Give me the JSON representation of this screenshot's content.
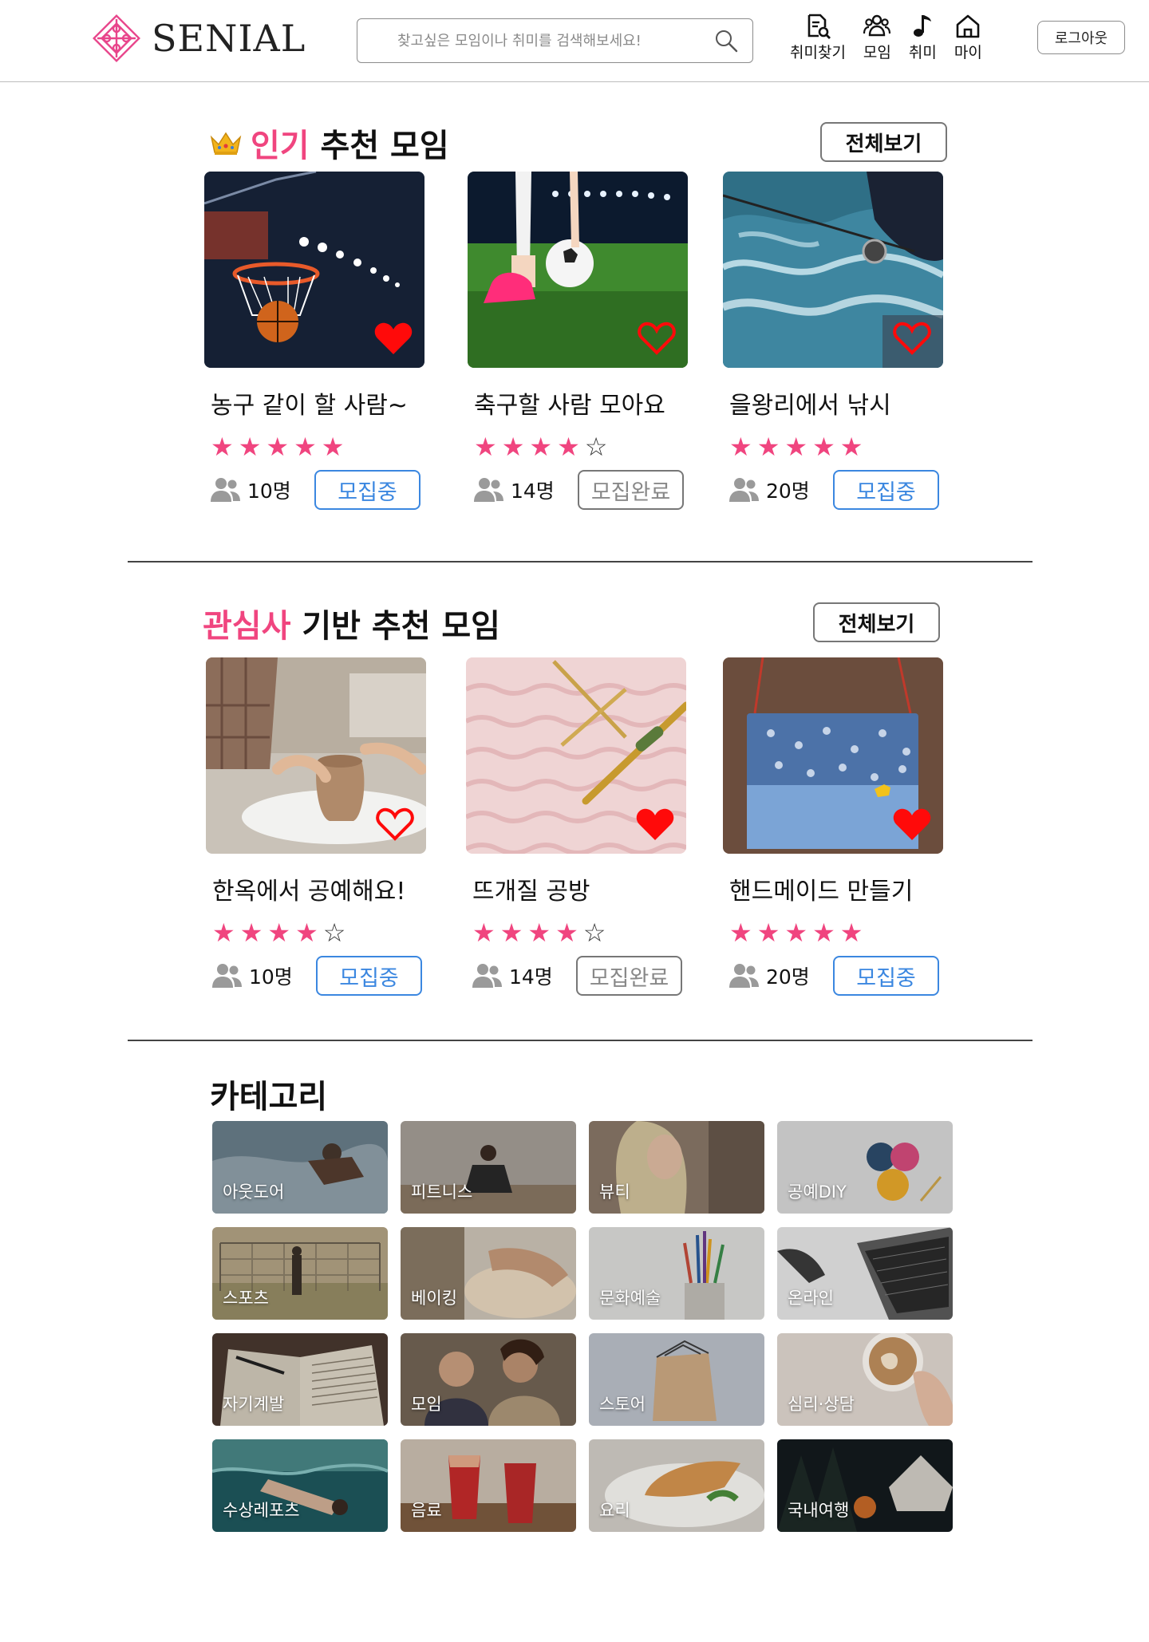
{
  "header": {
    "brand": "SENIAL",
    "search_placeholder": "찾고싶은 모임이나 취미를 검색해보세요!",
    "nav": [
      {
        "label": "취미찾기",
        "icon": "hobby-search-icon"
      },
      {
        "label": "모임",
        "icon": "group-icon"
      },
      {
        "label": "취미",
        "icon": "music-note-icon"
      },
      {
        "label": "마이",
        "icon": "home-icon"
      }
    ],
    "logout_label": "로그아웃"
  },
  "popular": {
    "title_highlight": "인기",
    "title_rest": " 추천 모임",
    "view_all": "전체보기",
    "cards": [
      {
        "title": "농구 같이 할 사람~",
        "rating": 5,
        "members": "10명",
        "status": "모집중",
        "status_type": "open",
        "liked": true
      },
      {
        "title": "축구할 사람 모아요",
        "rating": 4,
        "members": "14명",
        "status": "모집완료",
        "status_type": "closed",
        "liked": false
      },
      {
        "title": "을왕리에서 낚시",
        "rating": 5,
        "members": "20명",
        "status": "모집중",
        "status_type": "open",
        "liked": false
      }
    ]
  },
  "interest": {
    "title_highlight": "관심사",
    "title_rest": " 기반 추천 모임",
    "view_all": "전체보기",
    "cards": [
      {
        "title": "한옥에서 공예해요!",
        "rating": 4,
        "members": "10명",
        "status": "모집중",
        "status_type": "open",
        "liked": false
      },
      {
        "title": "뜨개질 공방",
        "rating": 4,
        "members": "14명",
        "status": "모집완료",
        "status_type": "closed",
        "liked": true
      },
      {
        "title": "핸드메이드 만들기",
        "rating": 5,
        "members": "20명",
        "status": "모집중",
        "status_type": "open",
        "liked": true
      }
    ]
  },
  "categories": {
    "title": "카테고리",
    "items": [
      "아웃도어",
      "피트니스",
      "뷰티",
      "공예DIY",
      "스포츠",
      "베이킹",
      "문화예술",
      "온라인",
      "자기계발",
      "모임",
      "스토어",
      "심리·상담",
      "수상레포츠",
      "음료",
      "요리",
      "국내여행"
    ]
  },
  "colors": {
    "accent": "#f0457f",
    "open": "#3b87e0",
    "closed": "#777777",
    "heart": "#ff0a0a"
  }
}
